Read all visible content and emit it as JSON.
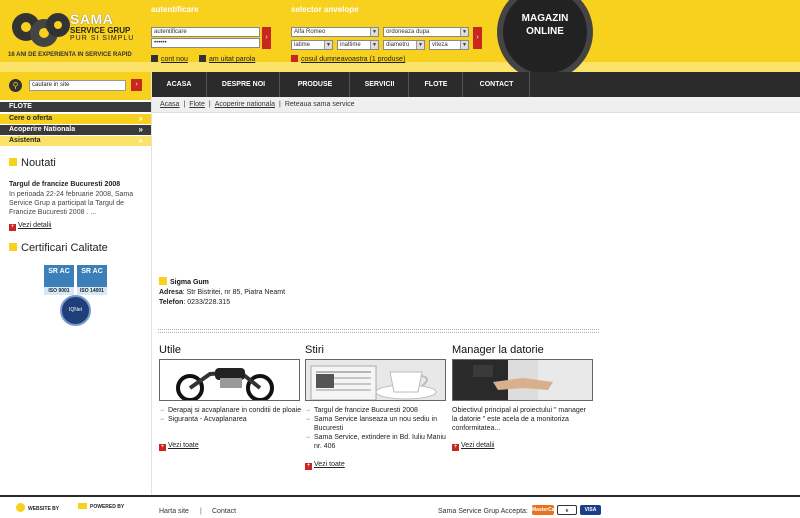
{
  "header": {
    "brand_line1": "SAMA",
    "brand_line2": "SERVICE GRUP",
    "tagline": "PUR SI SIMPLU",
    "years": "16 ANI DE EXPERIENTA IN SERVICE RAPID",
    "auth_label": "autentificare",
    "user_value": "autentificare",
    "pass_value": "••••••",
    "new_account": "cont nou",
    "forgot_password": "am uitat parola",
    "selector_label": "selector anvelope",
    "brand_select": "Alfa Romeo",
    "sort_select": "ordoneaza dupa",
    "width_select": "latime",
    "height_select": "inaltime",
    "diameter_select": "diametru",
    "speed_select": "viteza",
    "cart_link": "cosul dumneavoastra (1 produse)",
    "shop_line1": "MAGAZIN",
    "shop_line2": "ONLINE"
  },
  "search": {
    "value": "cautare in site"
  },
  "left_nav": {
    "items": [
      {
        "label": "FLOTE"
      },
      {
        "label": "Cere o oferta"
      },
      {
        "label": "Acoperire Nationala"
      },
      {
        "label": "Asistenta"
      }
    ]
  },
  "news": {
    "title": "Noutati",
    "headline": "Targul de francize Bucuresti 2008",
    "body": "In perioada 22-24 februarie 2008, Sama Service Grup a participat la Targul de Francize Bucuresti 2008 . ...",
    "more": "Vezi detalii"
  },
  "quality": {
    "title": "Certificari Calitate",
    "iso9001_top": "SR AC",
    "iso9001": "ISO 9001",
    "iso14001_top": "SR AC",
    "iso14001": "ISO 14001",
    "iqnet": "IQNet"
  },
  "top_nav": {
    "tabs": [
      {
        "label": "ACASA"
      },
      {
        "label": "DESPRE NOI"
      },
      {
        "label": "PRODUSE"
      },
      {
        "label": "SERVICII"
      },
      {
        "label": "FLOTE"
      },
      {
        "label": "CONTACT"
      }
    ]
  },
  "breadcrumb": {
    "items": [
      "Acasa",
      "Flote",
      "Acoperire nationala"
    ],
    "current": "Reteaua sama service"
  },
  "branch": {
    "name": "Sigma Gum",
    "address_label": "Adresa",
    "address": ": Str Bistritei, nr 85, Piatra Neamt",
    "phone_label": "Telefon",
    "phone": ": 0233/228.315"
  },
  "columns": {
    "utile": {
      "title": "Utile",
      "items": [
        "Derapaj si acvaplanare in conditii de ploaie",
        "Siguranta - Acvaplanarea"
      ],
      "more": "Vezi toate"
    },
    "stiri": {
      "title": "Stiri",
      "items": [
        "Targul de francize Bucuresti 2008",
        "Sama Service lanseaza un nou sediu in Bucuresti",
        "Sama Service, extindere in Bd. Iuliu Maniu nr. 406"
      ],
      "more": "Vezi toate"
    },
    "manager": {
      "title": "Manager la datorie",
      "desc": "Obiectivul principal al proiectului \" manager la datorie \" este acela de a monitoriza conformitatea...",
      "more": "Vezi detalii"
    }
  },
  "footer": {
    "website_by": "WEBSITE BY",
    "powered_by": "POWERED BY",
    "site_map": "Harta site",
    "contact": "Contact",
    "accepts": "Sama Service Grup Accepta:",
    "mastercard": "MasterCard",
    "visa": "VISA"
  }
}
